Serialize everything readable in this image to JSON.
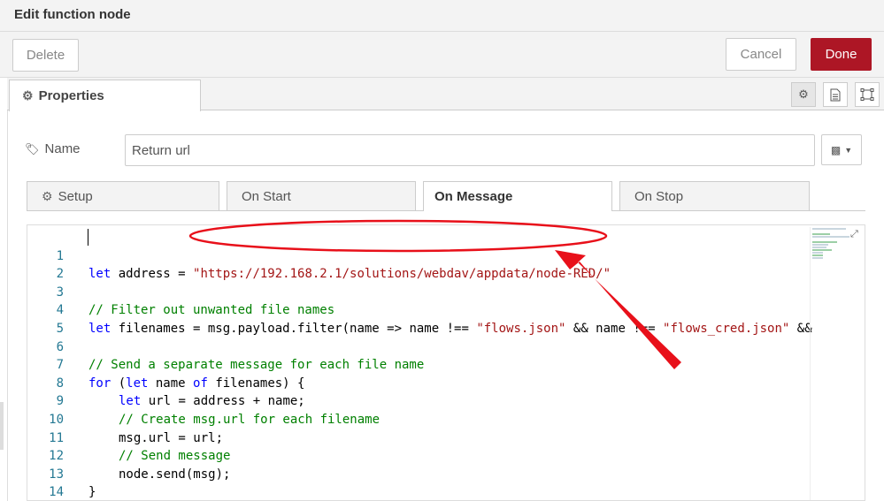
{
  "dialog": {
    "title": "Edit function node"
  },
  "toolbar": {
    "delete_label": "Delete",
    "cancel_label": "Cancel",
    "done_label": "Done"
  },
  "tabs": {
    "properties_label": "Properties"
  },
  "tab_icons": [
    "gear-icon",
    "description-icon",
    "appearance-icon"
  ],
  "name_field": {
    "label": "Name",
    "value": "Return url"
  },
  "code_tabs": [
    {
      "label": "Setup"
    },
    {
      "label": "On Start"
    },
    {
      "label": "On Message",
      "active": true
    },
    {
      "label": "On Stop"
    }
  ],
  "code": {
    "line_numbers": [
      "1",
      "2",
      "3",
      "4",
      "5",
      "6",
      "7",
      "8",
      "9",
      "10",
      "11",
      "12",
      "13",
      "14"
    ],
    "l1": {
      "kw": "let",
      "rest": " address = ",
      "str": "\"https://192.168.2.1/solutions/webdav/appdata/node-RED/\""
    },
    "l3": "// Filter out unwanted file names",
    "l4": {
      "kw": "let",
      "rest": " filenames = msg.payload.filter(name => name !== ",
      "s1": "\"flows.json\"",
      "mid": " && name !== ",
      "s2": "\"flows_cred.json\"",
      "end": " &&"
    },
    "l6": "// Send a separate message for each file name",
    "l7": {
      "kw": "for",
      "a": " (",
      "kw2": "let",
      "b": " name ",
      "kw3": "of",
      "c": " filenames) {"
    },
    "l8": {
      "kw": "let",
      "rest": " url = address + name;"
    },
    "l9": "// Create msg.url for each filename",
    "l10": "msg.url = url;",
    "l11": "// Send message",
    "l12": "node.send(msg);",
    "l13": "}"
  },
  "colors": {
    "accent": "#ad1625",
    "annotation": "#e8101a"
  }
}
